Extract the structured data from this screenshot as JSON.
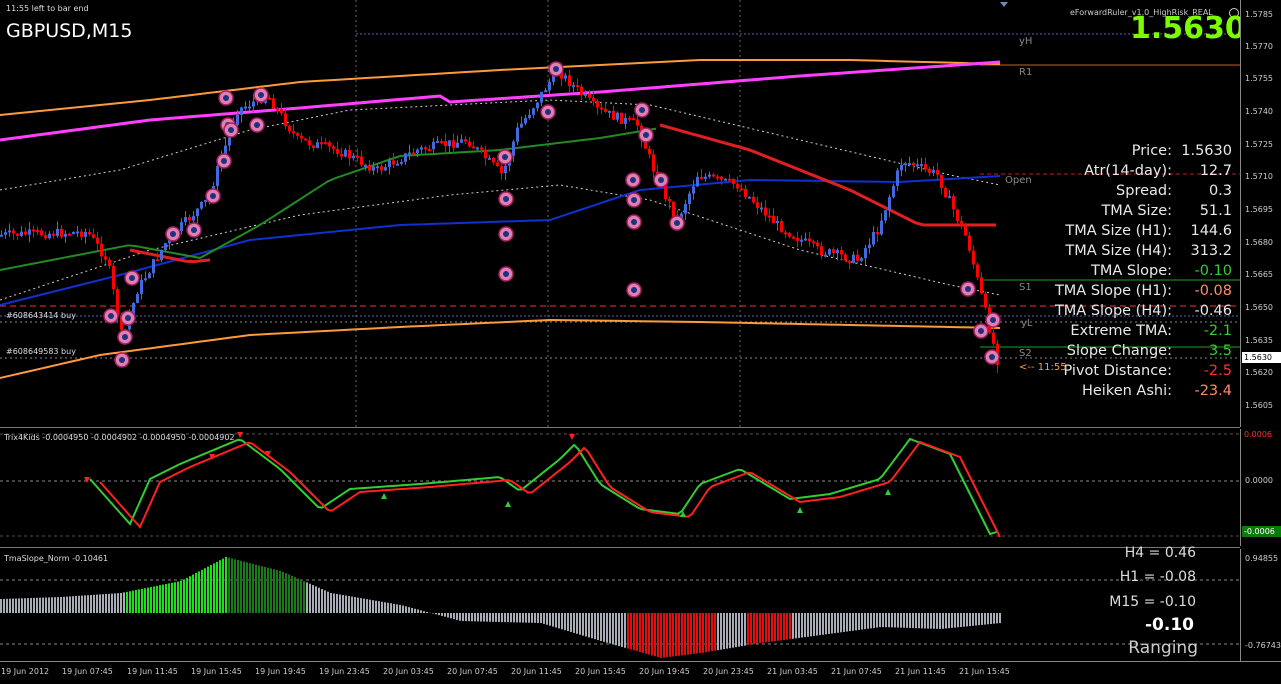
{
  "chart_header": {
    "timer": "11:55 left to bar end",
    "symbol": "GBPUSD,M15",
    "ea_name": "eForwardRuler_v1.0_HighRisk_REAL",
    "big_price": "1.5630"
  },
  "colors": {
    "background": "#000000",
    "bull_candle": "#4169e1",
    "bear_candle": "#ff0000",
    "tma_upper_outer": "#ff9a3c",
    "pivot_line": "#ff40ff",
    "green_ma": "#228b22",
    "blue_ma": "#1030d0",
    "tma_center": "#e02020",
    "big_price": "#7cfc00",
    "trix_green": "#32cd32",
    "trix_red": "#ff2020",
    "hist_bright_green": "#22dd22",
    "hist_dark_green": "#1a7a1a",
    "hist_grey": "#a8adb8",
    "hist_red": "#dd1111"
  },
  "stats": [
    {
      "label": "Price:",
      "value": "1.5630",
      "color": "#e8e8e8"
    },
    {
      "label": "Atr(14-day):",
      "value": "12.7",
      "color": "#e8e8e8"
    },
    {
      "label": "Spread:",
      "value": "0.3",
      "color": "#e8e8e8"
    },
    {
      "label": "TMA Size:",
      "value": "51.1",
      "color": "#e8e8e8"
    },
    {
      "label": "TMA Size (H1):",
      "value": "144.6",
      "color": "#e8e8e8"
    },
    {
      "label": "TMA Size (H4):",
      "value": "313.2",
      "color": "#e8e8e8"
    },
    {
      "label": "TMA Slope:",
      "value": "-0.10",
      "color": "#32cd32"
    },
    {
      "label": "TMA Slope (H1):",
      "value": "-0.08",
      "color": "#ff8c69"
    },
    {
      "label": "TMA Slope (H4):",
      "value": "-0.46",
      "color": "#e8e8e8"
    },
    {
      "label": "Extreme TMA:",
      "value": "-2.1",
      "color": "#32cd32"
    },
    {
      "label": "Slope Change:",
      "value": "3.5",
      "color": "#32cd32"
    },
    {
      "label": "Pivot Distance:",
      "value": "-2.5",
      "color": "#ff3030"
    },
    {
      "label": "Heiken Ashi:",
      "value": "-23.4",
      "color": "#ff8c69"
    }
  ],
  "levels": {
    "yH": "yH",
    "R1": "R1",
    "open": "Open",
    "S1": "S1",
    "yL": "yL",
    "S2": "S2",
    "time_marker": "<-- 11:55"
  },
  "orders": [
    {
      "label": "#608643414 buy"
    },
    {
      "label": "#608649583 buy"
    }
  ],
  "main_price_axis": [
    "1.5785",
    "1.5770",
    "1.5755",
    "1.5740",
    "1.5725",
    "1.5710",
    "1.5695",
    "1.5680",
    "1.5665",
    "1.5650",
    "1.5635",
    "1.5620",
    "1.5605"
  ],
  "current_price_box": "1.5630",
  "trix": {
    "name": "Trix4Kids -0.0004950 -0.0004902 -0.0004950 -0.0004902",
    "axis": [
      "0.0006",
      "0.0000",
      "-0.0006"
    ]
  },
  "slope": {
    "name": "TmaSlope_Norm -0.10461",
    "axis": [
      "0.94855",
      "-0.76743"
    ],
    "h4": "H4 = 0.46",
    "h1": "H1 = -0.08",
    "m15": "M15 = -0.10",
    "current": "-0.10",
    "state": "Ranging"
  },
  "time_axis": [
    "19 Jun 2012",
    "19 Jun 07:45",
    "19 Jun 11:45",
    "19 Jun 15:45",
    "19 Jun 19:45",
    "19 Jun 23:45",
    "20 Jun 03:45",
    "20 Jun 07:45",
    "20 Jun 11:45",
    "20 Jun 15:45",
    "20 Jun 19:45",
    "20 Jun 23:45",
    "21 Jun 03:45",
    "21 Jun 07:45",
    "21 Jun 11:45",
    "21 Jun 15:45"
  ]
}
